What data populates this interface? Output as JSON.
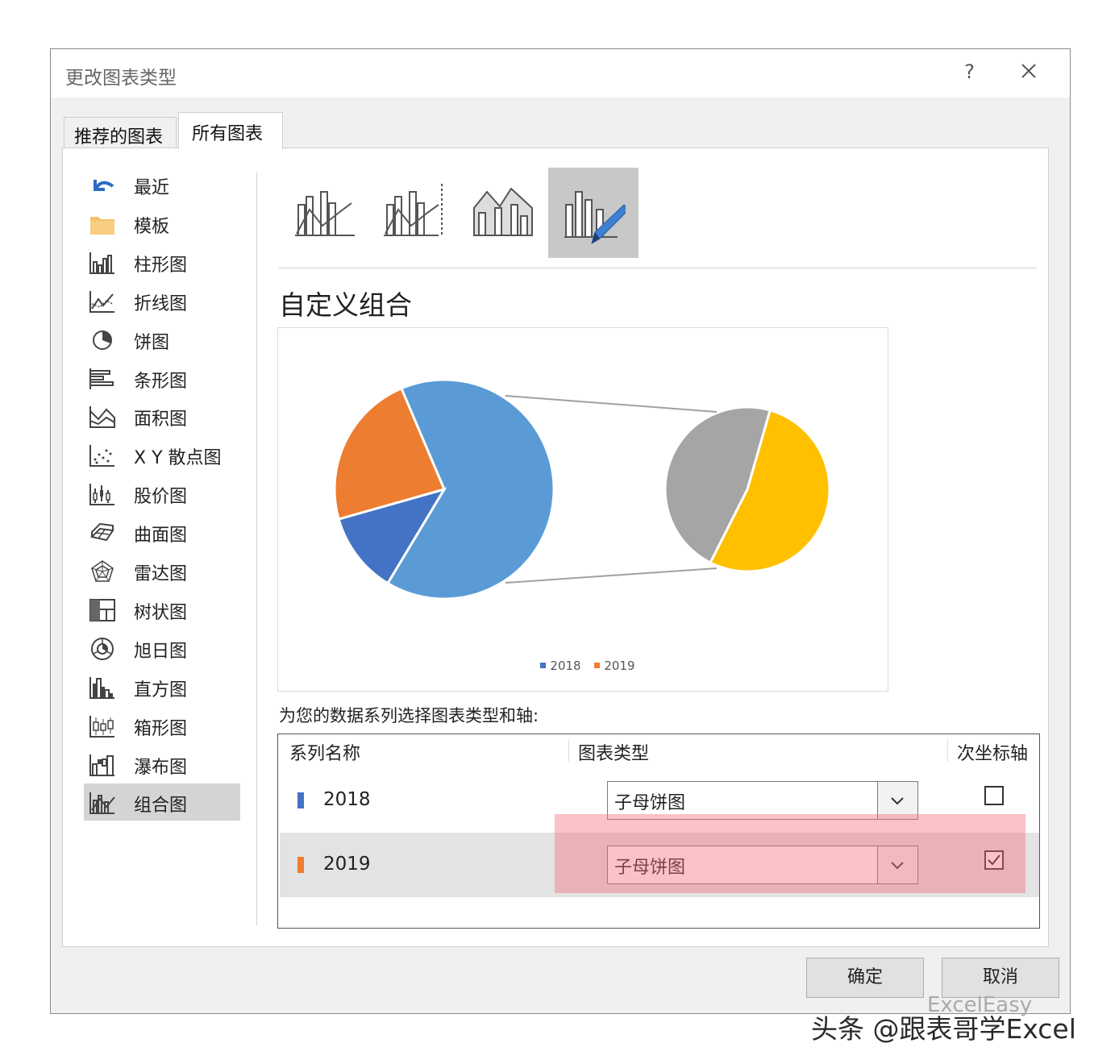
{
  "dialog": {
    "title": "更改图表类型",
    "help_label": "?",
    "tabs": [
      {
        "label": "推荐的图表"
      },
      {
        "label": "所有图表"
      }
    ]
  },
  "sidebar": {
    "items": [
      {
        "label": "最近",
        "icon": "undo-arrow-icon"
      },
      {
        "label": "模板",
        "icon": "folder-icon"
      },
      {
        "label": "柱形图",
        "icon": "column-chart-icon"
      },
      {
        "label": "折线图",
        "icon": "line-chart-icon"
      },
      {
        "label": "饼图",
        "icon": "pie-chart-icon"
      },
      {
        "label": "条形图",
        "icon": "bar-chart-icon"
      },
      {
        "label": "面积图",
        "icon": "area-chart-icon"
      },
      {
        "label": "X Y 散点图",
        "icon": "scatter-chart-icon"
      },
      {
        "label": "股价图",
        "icon": "stock-chart-icon"
      },
      {
        "label": "曲面图",
        "icon": "surface-chart-icon"
      },
      {
        "label": "雷达图",
        "icon": "radar-chart-icon"
      },
      {
        "label": "树状图",
        "icon": "treemap-chart-icon"
      },
      {
        "label": "旭日图",
        "icon": "sunburst-chart-icon"
      },
      {
        "label": "直方图",
        "icon": "histogram-chart-icon"
      },
      {
        "label": "箱形图",
        "icon": "box-whisker-chart-icon"
      },
      {
        "label": "瀑布图",
        "icon": "waterfall-chart-icon"
      },
      {
        "label": "组合图",
        "icon": "combo-chart-icon",
        "selected": true
      }
    ]
  },
  "subtypes": [
    {
      "icon": "clustered-column-line-icon"
    },
    {
      "icon": "clustered-column-line-secondary-axis-icon"
    },
    {
      "icon": "stacked-area-clustered-column-icon"
    },
    {
      "icon": "custom-combination-icon",
      "selected": true
    }
  ],
  "main": {
    "section_title": "自定义组合",
    "legend": [
      {
        "name": "2018",
        "color": "#4472c4"
      },
      {
        "name": "2019",
        "color": "#ed7d31"
      }
    ],
    "instruction": "为您的数据系列选择图表类型和轴:",
    "grid": {
      "headers": {
        "series_name": "系列名称",
        "chart_type": "图表类型",
        "secondary_axis": "次坐标轴"
      },
      "rows": [
        {
          "name": "2018",
          "swatch_color": "#4472c4",
          "chart_type": "子母饼图",
          "secondary_axis": false
        },
        {
          "name": "2019",
          "swatch_color": "#ed7d31",
          "chart_type": "子母饼图",
          "secondary_axis": true
        }
      ]
    }
  },
  "chart_data": {
    "type": "pie",
    "subtype": "pie-of-pie",
    "main_pie": [
      {
        "color": "#5b9bd5",
        "value": 0.65
      },
      {
        "color": "#4472c4",
        "value": 0.12
      },
      {
        "color": "#ed7d31",
        "value": 0.23
      }
    ],
    "secondary_pie": [
      {
        "color": "#ffc000",
        "value": 0.53
      },
      {
        "color": "#a5a5a5",
        "value": 0.47
      }
    ],
    "legend": [
      "2018",
      "2019"
    ]
  },
  "footer": {
    "ok_label": "确定",
    "cancel_label": "取消"
  },
  "watermark": {
    "text": "头条 @跟表哥学Excel",
    "logo_text": "ExcelEasy"
  },
  "colors": {
    "highlight": "#f06e78",
    "selected_bg": "#d4d4d4"
  }
}
